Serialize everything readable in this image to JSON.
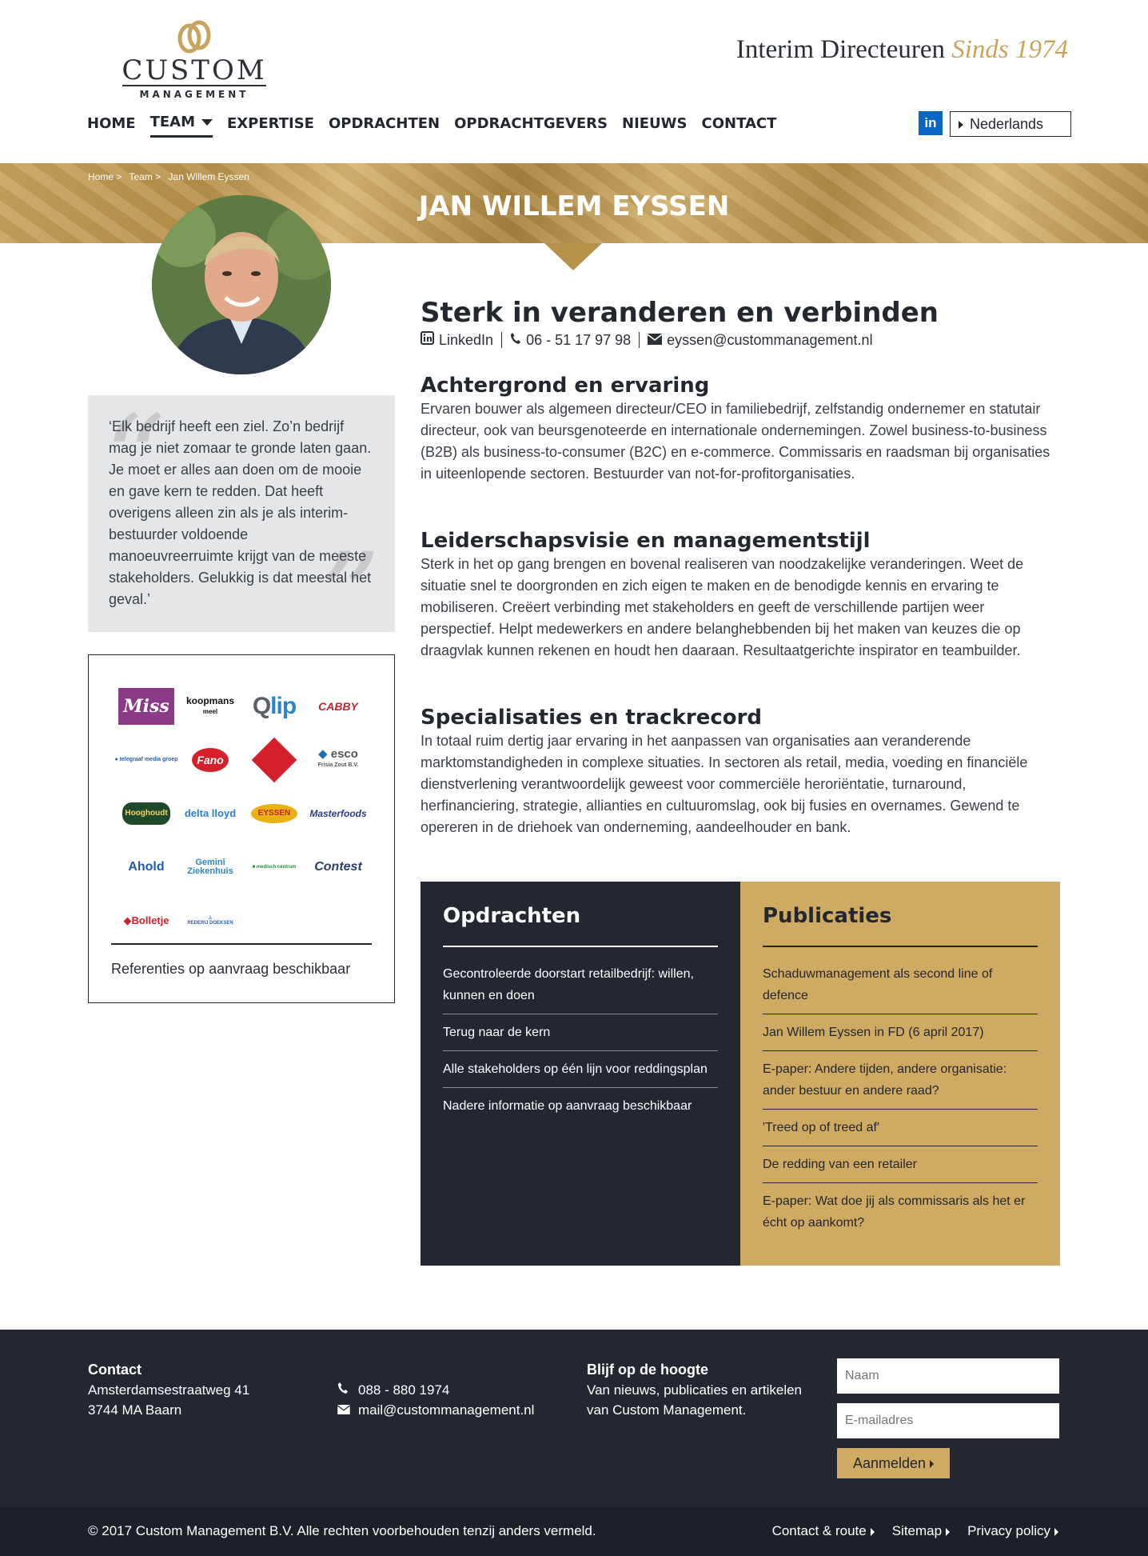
{
  "brand": {
    "logo_word": "CUSTOM",
    "logo_sub": "MANAGEMENT",
    "tagline_main": "Interim Directeuren",
    "tagline_gold": "Sinds 1974",
    "gold_color": "#c9a45c",
    "dark_color": "#232830"
  },
  "nav": {
    "items": [
      "HOME",
      "TEAM",
      "EXPERTISE",
      "OPDRACHTEN",
      "OPDRACHTGEVERS",
      "NIEUWS",
      "CONTACT"
    ],
    "active": "TEAM",
    "linkedin_label": "in",
    "language": "Nederlands"
  },
  "breadcrumb": [
    "Home >",
    "Team >",
    "Jan Willem Eyssen"
  ],
  "page_title": "JAN WILLEM EYSSEN",
  "quote": "‘Elk bedrijf heeft een ziel. Zo’n bedrijf mag je niet zomaar te gronde laten gaan. Je moet er alles aan doen om de mooie en gave kern te redden. Dat heeft overigens alleen zin als je als interim-bestuurder voldoende manoeuvreerruimte krijgt van de meeste stakeholders. Gelukkig is dat meestal het geval.’",
  "references": {
    "logos": [
      "Miss Etam",
      "koopmans meel",
      "Qlip",
      "CABBY",
      "telegraaf media groep",
      "Fano",
      "qility",
      "esco Frisia Zout B.V.",
      "Hooghoudt",
      "delta lloyd",
      "EYSSEN",
      "Masterfoods",
      "Ahold",
      "Gemini Ziekenhuis",
      "medisch centrum",
      "Contest",
      "Bolletje",
      "Rederij Doeksen"
    ],
    "note": "Referenties op aanvraag beschikbaar"
  },
  "profile": {
    "headline": "Sterk in veranderen en verbinden",
    "linkedin": "LinkedIn",
    "phone": "06 - 51 17 97 98",
    "email": "eyssen@custommanagement.nl"
  },
  "sections": [
    {
      "title": "Achtergrond en ervaring",
      "text": "Ervaren bouwer als algemeen directeur/CEO in familiebedrijf, zelfstandig ondernemer en statutair directeur, ook van beursgenoteerde en internationale ondernemingen. Zowel business-to-business (B2B) als business-to-consumer (B2C) en e-commerce. Commissaris en raadsman bij organisaties in uiteenlopende sectoren. Bestuurder van not-for-profitorganisaties."
    },
    {
      "title": "Leiderschapsvisie en managementstijl",
      "text": "Sterk in het op gang brengen en bovenal realiseren van noodzakelijke veranderingen. Weet de situatie snel te doorgronden en zich eigen te maken en de benodigde kennis en ervaring te mobiliseren. Creëert verbinding met stakeholders en geeft de verschillende partijen weer perspectief. Helpt medewerkers en andere belanghebbenden bij het maken van keuzes die op draagvlak kunnen rekenen en houdt hen daaraan. Resultaatgerichte inspirator en teambuilder."
    },
    {
      "title": "Specialisaties en trackrecord",
      "text": "In totaal ruim dertig jaar ervaring in het aanpassen van organisaties aan veranderende marktomstandigheden in complexe situaties. In sectoren als retail, media, voeding en financiële dienstverlening verantwoordelijk geweest voor commerciële heroriëntatie, turnaround, herfinanciering, strategie, allianties en cultuuromslag, ook bij fusies en overnames. Gewend te opereren in de driehoek van onderneming, aandeelhouder en bank."
    }
  ],
  "opdrachten": {
    "title": "Opdrachten",
    "items": [
      "Gecontroleerde doorstart retailbedrijf: willen, kunnen en doen",
      "Terug naar de kern",
      "Alle stakeholders op één lijn voor reddingsplan",
      "Nadere informatie op aanvraag beschikbaar"
    ]
  },
  "publicaties": {
    "title": "Publicaties",
    "items": [
      "Schaduwmanagement als second line of defence",
      "Jan Willem Eyssen in FD (6 april 2017)",
      "E-paper: Andere tijden, andere organisatie: ander bestuur en andere raad?",
      "'Treed op of treed af'",
      "De redding van een retailer",
      "E-paper: Wat doe jij als commissaris als het er écht op aankomt?"
    ]
  },
  "footer": {
    "contact_title": "Contact",
    "address1": "Amsterdamsestraatweg 41",
    "address2": "3744 MA Baarn",
    "phone": "088 - 880 1974",
    "email": "mail@custommanagement.nl",
    "news_title": "Blijf op de hoogte",
    "news_text1": "Van nieuws, publicaties en artikelen",
    "news_text2": "van Custom Management.",
    "name_placeholder": "Naam",
    "email_placeholder": "E-mailadres",
    "submit": "Aanmelden",
    "copyright": "© 2017 Custom Management B.V. Alle rechten voorbehouden tenzij anders vermeld.",
    "links": [
      "Contact & route",
      "Sitemap",
      "Privacy policy"
    ]
  }
}
